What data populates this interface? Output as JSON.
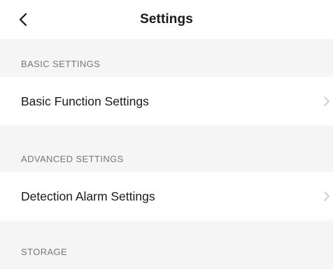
{
  "header": {
    "title": "Settings",
    "back_icon": "chevron-left-icon"
  },
  "sections": [
    {
      "label": "BASIC SETTINGS",
      "items": [
        {
          "label": "Basic Function Settings",
          "icon": "chevron-right-icon"
        }
      ]
    },
    {
      "label": "ADVANCED SETTINGS",
      "items": [
        {
          "label": "Detection Alarm Settings",
          "icon": "chevron-right-icon"
        }
      ]
    },
    {
      "label": "STORAGE",
      "items": []
    }
  ],
  "colors": {
    "page_background": "#f5f5f5",
    "row_background": "#ffffff",
    "section_label": "#777777",
    "chevron": "#c8c8c8"
  }
}
